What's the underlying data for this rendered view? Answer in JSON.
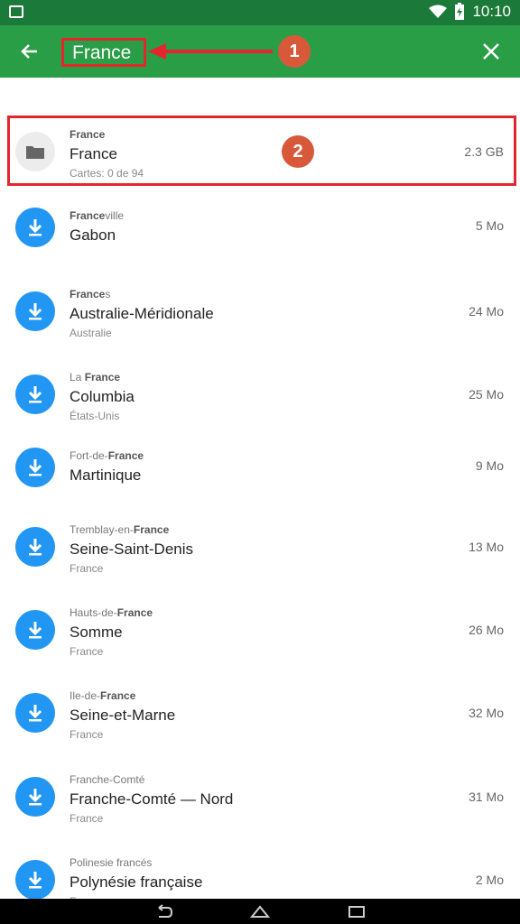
{
  "status": {
    "time": "10:10"
  },
  "toolbar": {
    "search_value": "France"
  },
  "annotations": {
    "marker1": "1",
    "marker2": "2"
  },
  "rows": [
    {
      "pre_plain": "",
      "pre_bold": "France",
      "pre_after": "",
      "name": "France",
      "sub": "Cartes: 0 de 94",
      "size": "2.3 GB",
      "icon": "folder-icon"
    },
    {
      "pre_plain": "",
      "pre_bold": "France",
      "pre_after": "ville",
      "name": "Gabon",
      "sub": "",
      "size": "5 Mo",
      "icon": "download-icon"
    },
    {
      "pre_plain": "",
      "pre_bold": "France",
      "pre_after": "s",
      "name": "Australie-Méridionale",
      "sub": "Australie",
      "size": "24 Mo",
      "icon": "download-icon"
    },
    {
      "pre_plain": "La ",
      "pre_bold": "France",
      "pre_after": "",
      "name": "Columbia",
      "sub": "États-Unis",
      "size": "25 Mo",
      "icon": "download-icon"
    },
    {
      "pre_plain": "Fort-de-",
      "pre_bold": "France",
      "pre_after": "",
      "name": "Martinique",
      "sub": "",
      "size": "9 Mo",
      "icon": "download-icon"
    },
    {
      "pre_plain": "Tremblay-en-",
      "pre_bold": "France",
      "pre_after": "",
      "name": "Seine-Saint-Denis",
      "sub": "France",
      "size": "13 Mo",
      "icon": "download-icon"
    },
    {
      "pre_plain": "Hauts-de-",
      "pre_bold": "France",
      "pre_after": "",
      "name": "Somme",
      "sub": "France",
      "size": "26 Mo",
      "icon": "download-icon"
    },
    {
      "pre_plain": "Ile-de-",
      "pre_bold": "France",
      "pre_after": "",
      "name": "Seine-et-Marne",
      "sub": "France",
      "size": "32 Mo",
      "icon": "download-icon"
    },
    {
      "pre_plain": "Franche-Comté",
      "pre_bold": "",
      "pre_after": "",
      "name": "Franche-Comté — Nord",
      "sub": "France",
      "size": "31 Mo",
      "icon": "download-icon"
    },
    {
      "pre_plain": "Polinesie francés",
      "pre_bold": "",
      "pre_after": "",
      "name": "Polynésie française",
      "sub": "France",
      "size": "2 Mo",
      "icon": "download-icon"
    }
  ]
}
